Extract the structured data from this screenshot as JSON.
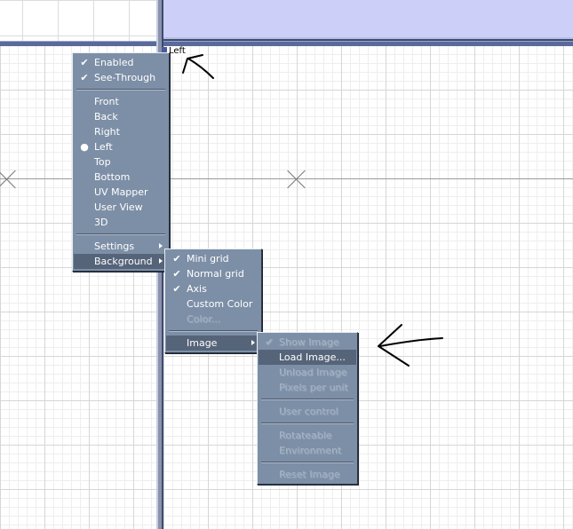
{
  "viewport": {
    "label": "Left"
  },
  "context_menu": {
    "items": [
      {
        "label": "Enabled",
        "mark": "check"
      },
      {
        "label": "See-Through",
        "mark": "check"
      },
      {
        "separator": true
      },
      {
        "label": "Front"
      },
      {
        "label": "Back"
      },
      {
        "label": "Right"
      },
      {
        "label": "Left",
        "mark": "bullet"
      },
      {
        "label": "Top"
      },
      {
        "label": "Bottom"
      },
      {
        "label": "UV Mapper"
      },
      {
        "label": "User View"
      },
      {
        "label": "3D"
      },
      {
        "separator": true
      },
      {
        "label": "Settings",
        "submenu": true
      },
      {
        "label": "Background",
        "submenu": true,
        "highlighted": true
      }
    ]
  },
  "background_submenu": {
    "items": [
      {
        "label": "Mini grid",
        "mark": "check"
      },
      {
        "label": "Normal grid",
        "mark": "check"
      },
      {
        "label": "Axis",
        "mark": "check"
      },
      {
        "label": "Custom Color"
      },
      {
        "label": "Color...",
        "disabled": true
      },
      {
        "separator": true
      },
      {
        "label": "Image",
        "submenu": true,
        "highlighted": true
      }
    ]
  },
  "image_submenu": {
    "items": [
      {
        "label": "Show Image",
        "mark": "check",
        "disabled": true
      },
      {
        "label": "Load Image...",
        "highlighted": true
      },
      {
        "label": "Unload Image",
        "disabled": true
      },
      {
        "label": "Pixels per unit",
        "disabled": true
      },
      {
        "separator": true
      },
      {
        "label": "User control",
        "disabled": true
      },
      {
        "separator": true
      },
      {
        "label": "Rotateable",
        "disabled": true
      },
      {
        "label": "Environment",
        "disabled": true
      },
      {
        "separator": true
      },
      {
        "label": "Reset Image",
        "disabled": true
      }
    ]
  },
  "marks": {
    "check": "✔",
    "bullet": "●"
  },
  "colors": {
    "menu_bg": "#7d8fa6",
    "highlight": "#566479",
    "viewport_header": "#ccd0f8",
    "annotation": "#000000"
  }
}
